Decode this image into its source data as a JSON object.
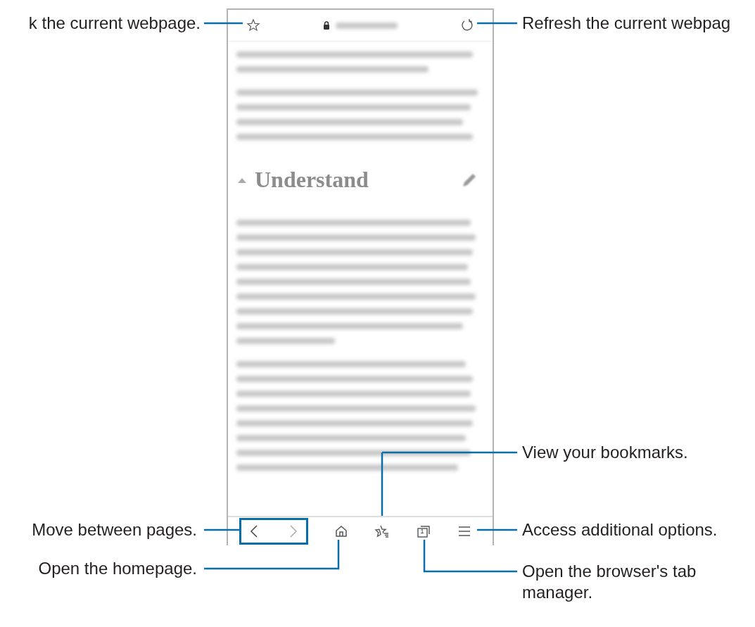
{
  "browser": {
    "tab_count": "1",
    "heading": "Understand"
  },
  "callouts": [
    {
      "text": "k the current webpage."
    },
    {
      "text": "Refresh the current webpag"
    },
    {
      "text": "View your bookmarks."
    },
    {
      "text": "Move between pages."
    },
    {
      "text": "Access additional options."
    },
    {
      "text": "Open the homepage."
    },
    {
      "text": "Open the browser's tab manager."
    }
  ]
}
